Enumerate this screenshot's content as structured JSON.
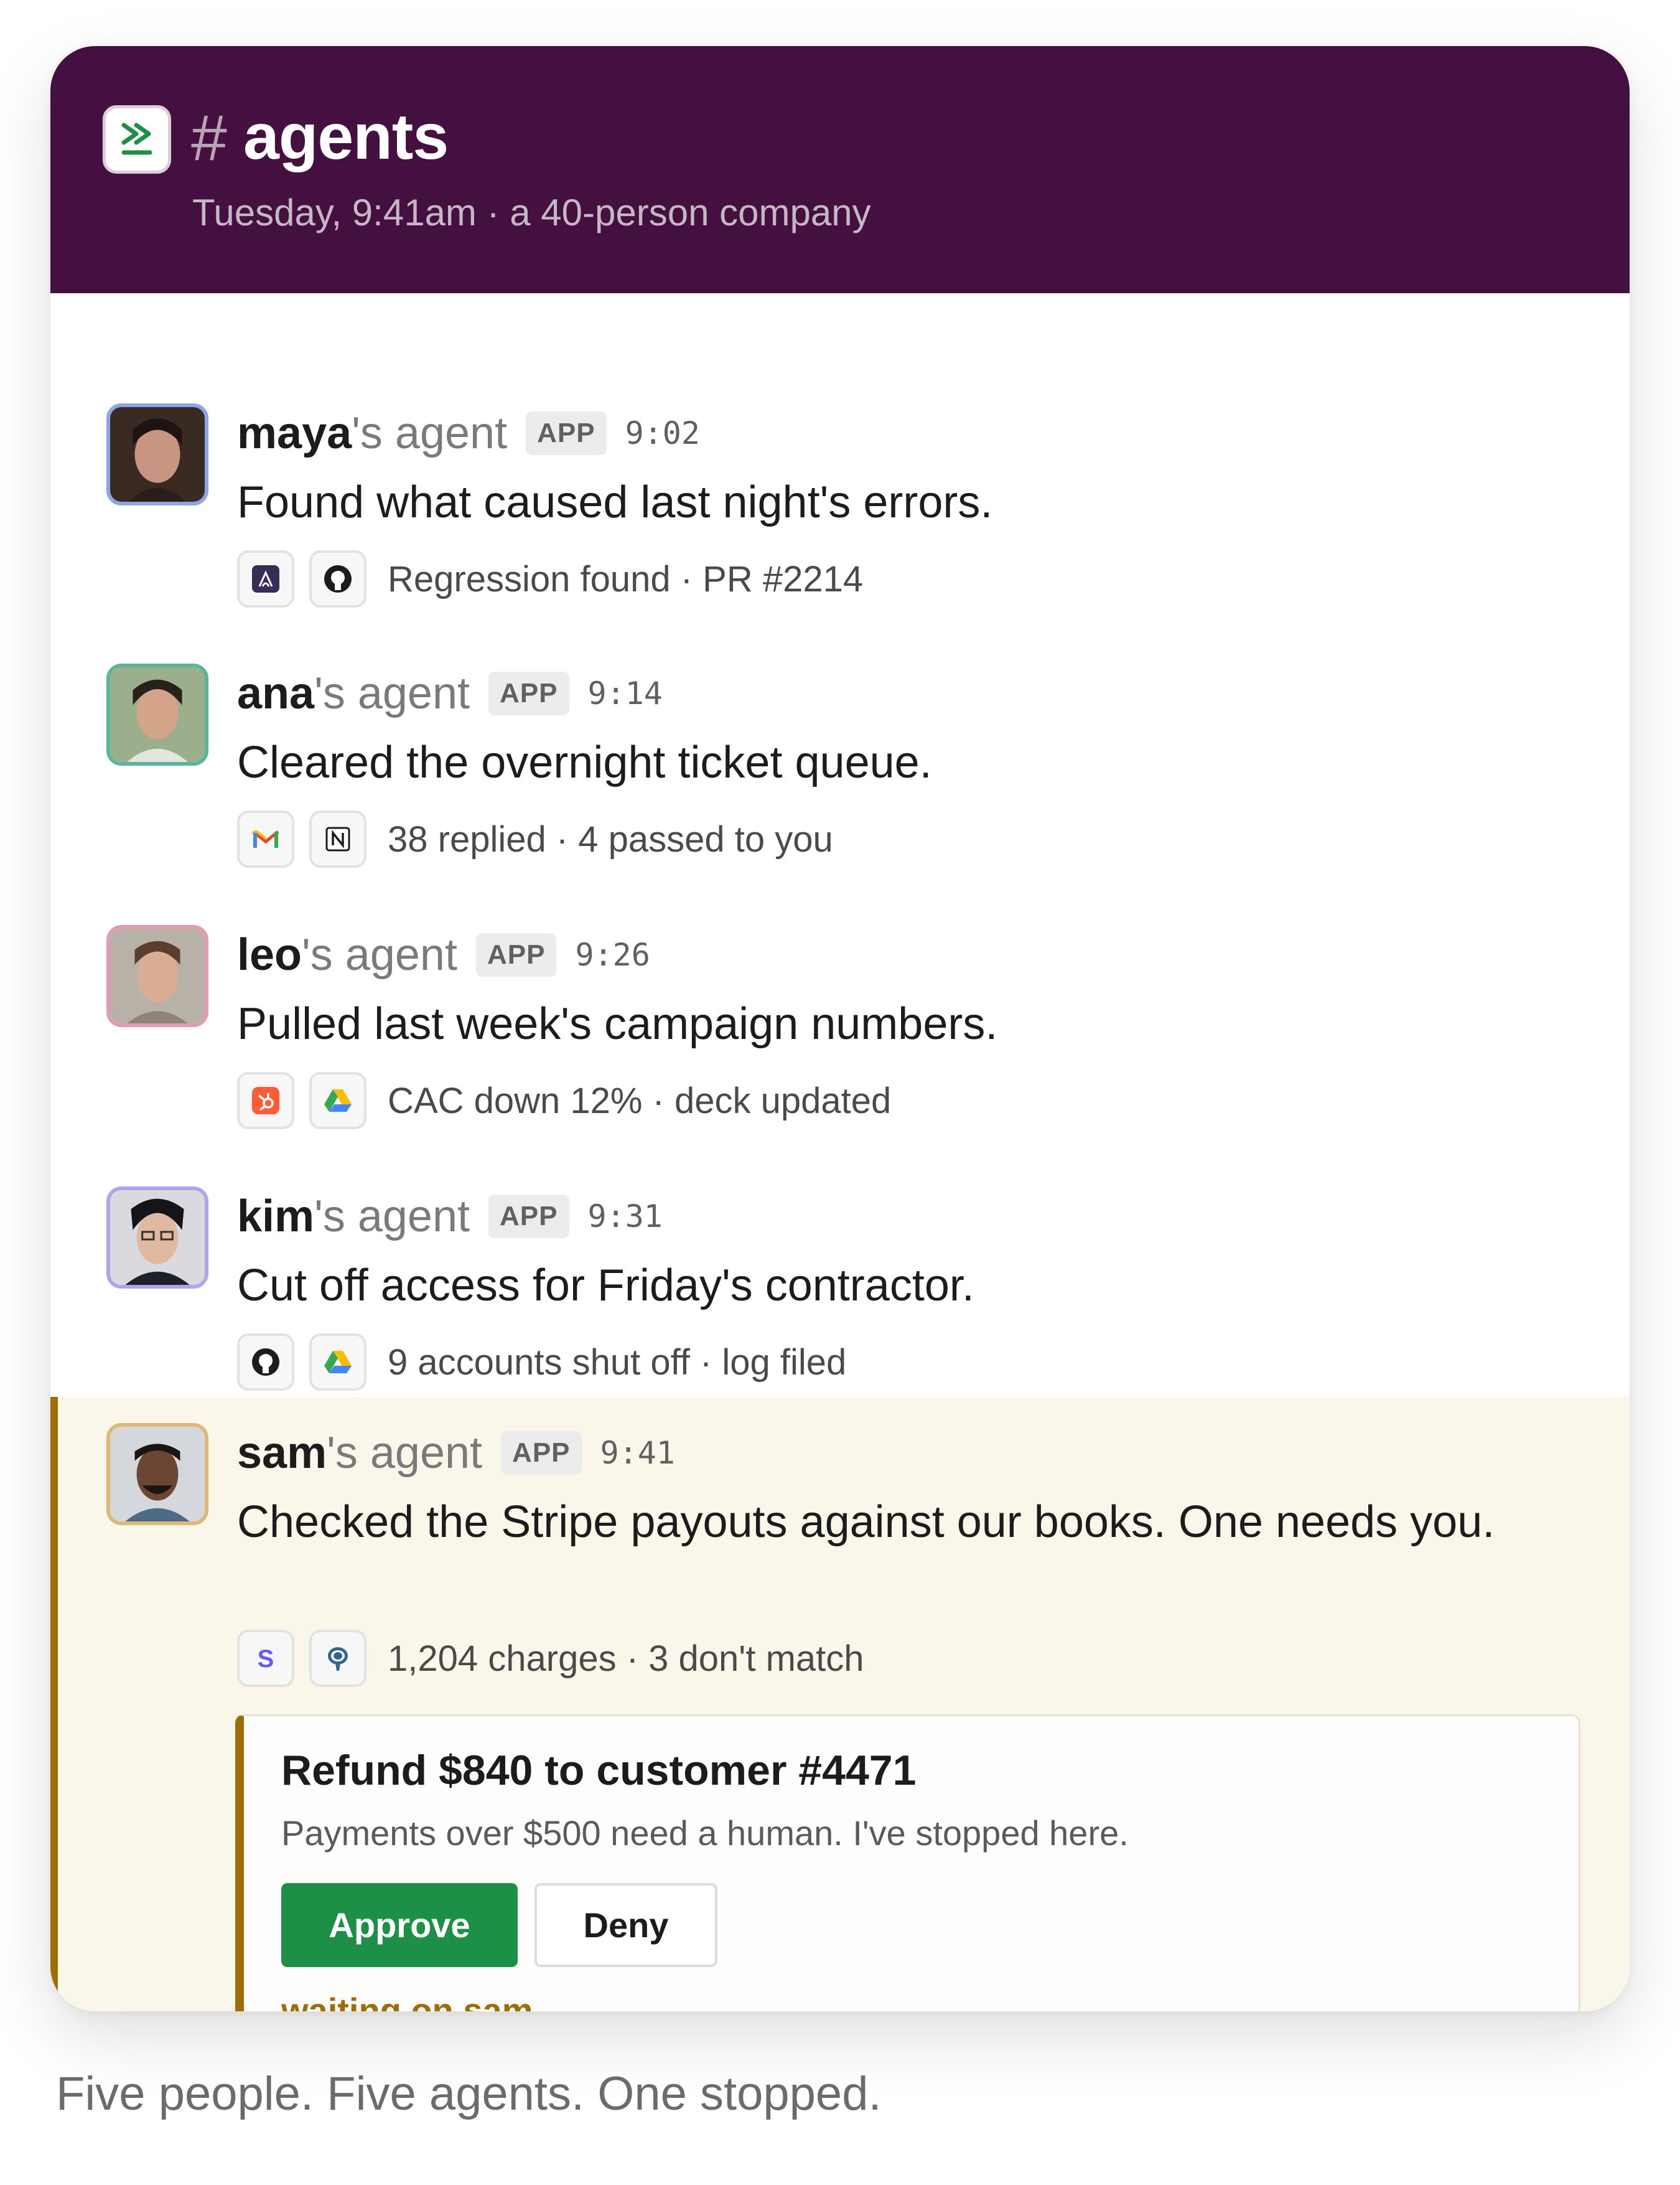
{
  "channel": {
    "hash": "#",
    "name": "agents",
    "subtitle": "Tuesday, 9:41am · a 40-person company",
    "logo_icon": "double-chevron-right-icon"
  },
  "messages": [
    {
      "user": "maya",
      "suffix": "'s agent",
      "badge": "APP",
      "time": "9:02",
      "text": "Found what caused last night's errors.",
      "tools": [
        "sentry-icon",
        "github-icon"
      ],
      "summary": "Regression found · PR #2214"
    },
    {
      "user": "ana",
      "suffix": "'s agent",
      "badge": "APP",
      "time": "9:14",
      "text": "Cleared the overnight ticket queue.",
      "tools": [
        "gmail-icon",
        "notion-icon"
      ],
      "summary": "38 replied · 4 passed to you"
    },
    {
      "user": "leo",
      "suffix": "'s agent",
      "badge": "APP",
      "time": "9:26",
      "text": "Pulled last week's campaign numbers.",
      "tools": [
        "hubspot-icon",
        "google-drive-icon"
      ],
      "summary": "CAC down 12% · deck updated"
    },
    {
      "user": "kim",
      "suffix": "'s agent",
      "badge": "APP",
      "time": "9:31",
      "text": "Cut off access for Friday's contractor.",
      "tools": [
        "github-icon",
        "google-drive-icon"
      ],
      "summary": "9 accounts shut off · log filed"
    },
    {
      "user": "sam",
      "suffix": "'s agent",
      "badge": "APP",
      "time": "9:41",
      "text": "Checked the Stripe payouts against our books. One needs you.",
      "tools": [
        "stripe-icon",
        "postgres-icon"
      ],
      "summary": "1,204 charges · 3 don't match"
    }
  ],
  "approval": {
    "title": "Refund $840 to customer #4471",
    "subtitle": "Payments over $500 need a human. I've stopped here.",
    "approve_label": "Approve",
    "deny_label": "Deny",
    "status": "waiting on sam"
  },
  "caption": "Five people. Five agents. One stopped.",
  "colors": {
    "header_bg": "#431040",
    "highlight_bg": "#faf7ea",
    "accent_gold": "#9e6d06",
    "approve_green": "#1e8f46"
  }
}
